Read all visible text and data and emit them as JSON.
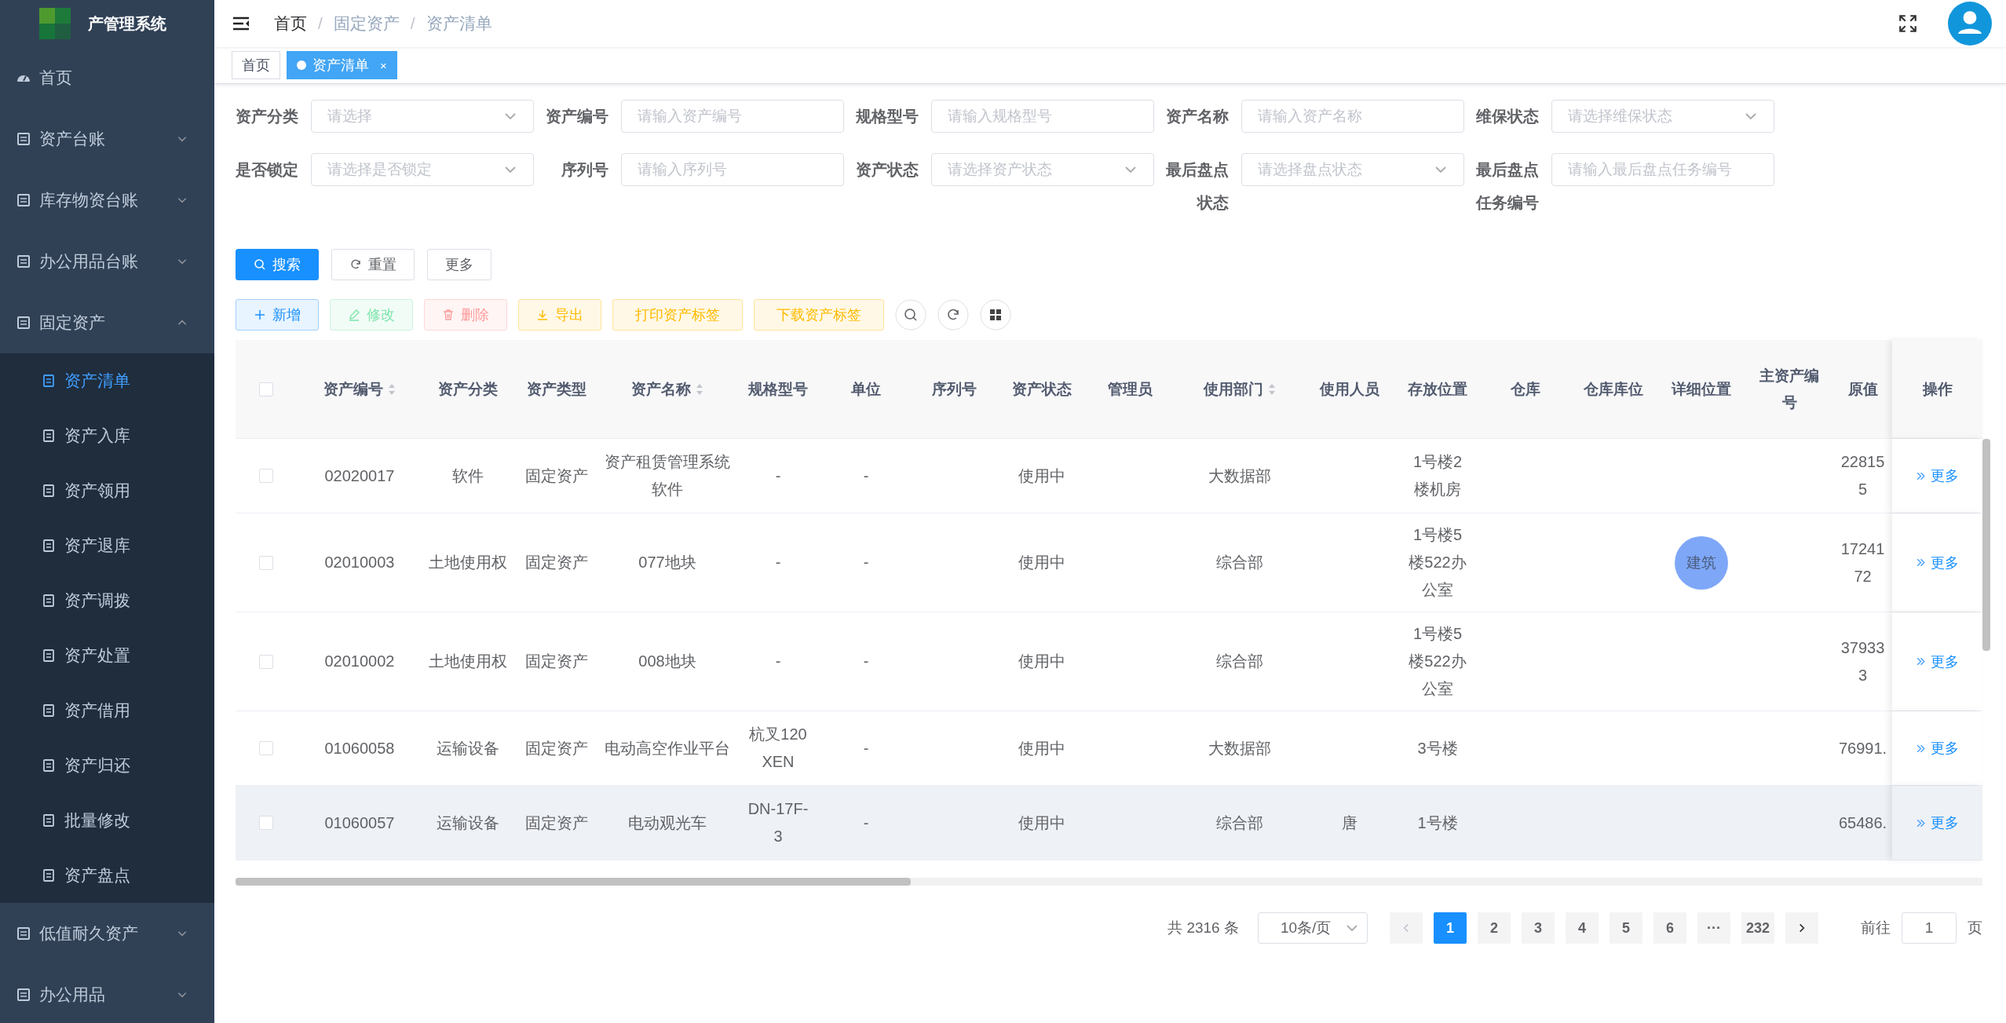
{
  "app": {
    "title": "产管理系统"
  },
  "sidebar": {
    "items": [
      {
        "label": "首页",
        "selected": false
      },
      {
        "label": "资产台账",
        "selected": false,
        "expanded": false
      },
      {
        "label": "库存物资台账",
        "selected": false,
        "expanded": false
      },
      {
        "label": "办公用品台账",
        "selected": false,
        "expanded": false
      },
      {
        "label": "固定资产",
        "selected": false,
        "expanded": true,
        "children": [
          {
            "label": "资产清单",
            "selected": true
          },
          {
            "label": "资产入库",
            "selected": false
          },
          {
            "label": "资产领用",
            "selected": false
          },
          {
            "label": "资产退库",
            "selected": false
          },
          {
            "label": "资产调拨",
            "selected": false
          },
          {
            "label": "资产处置",
            "selected": false
          },
          {
            "label": "资产借用",
            "selected": false
          },
          {
            "label": "资产归还",
            "selected": false
          },
          {
            "label": "批量修改",
            "selected": false
          },
          {
            "label": "资产盘点",
            "selected": false
          }
        ]
      },
      {
        "label": "低值耐久资产",
        "selected": false,
        "expanded": false
      },
      {
        "label": "办公用品",
        "selected": false,
        "expanded": false
      }
    ]
  },
  "breadcrumb": [
    "首页",
    "固定资产",
    "资产清单"
  ],
  "breadcrumb_separator": "/",
  "tags": [
    {
      "label": "首页",
      "selected": false
    },
    {
      "label": "资产清单",
      "selected": true,
      "close": "×"
    }
  ],
  "filters": [
    {
      "label": "资产分类",
      "kind": "select",
      "placeholder": "请选择"
    },
    {
      "label": "资产编号",
      "kind": "input",
      "placeholder": "请输入资产编号"
    },
    {
      "label": "规格型号",
      "kind": "input",
      "placeholder": "请输入规格型号"
    },
    {
      "label": "资产名称",
      "kind": "input",
      "placeholder": "请输入资产名称"
    },
    {
      "label": "维保状态",
      "kind": "select",
      "placeholder": "请选择维保状态"
    },
    {
      "label": "是否锁定",
      "kind": "select",
      "placeholder": "请选择是否锁定"
    },
    {
      "label": "序列号",
      "kind": "input",
      "placeholder": "请输入序列号"
    },
    {
      "label": "资产状态",
      "kind": "select",
      "placeholder": "请选择资产状态"
    },
    {
      "label": "最后盘点状态",
      "kind": "select",
      "placeholder": "请选择盘点状态"
    },
    {
      "label": "最后盘点任务编号",
      "kind": "input",
      "placeholder": "请输入最后盘点任务编号"
    }
  ],
  "form_buttons": [
    {
      "label": "搜索",
      "kind": "primary"
    },
    {
      "label": "重置",
      "kind": "reset"
    },
    {
      "label": "更多",
      "kind": "plain"
    }
  ],
  "toolbar": [
    {
      "label": "新增",
      "kind": "add",
      "disabled": false
    },
    {
      "label": "修改",
      "kind": "edit",
      "disabled": true
    },
    {
      "label": "删除",
      "kind": "delete",
      "disabled": true
    },
    {
      "label": "导出",
      "kind": "export",
      "disabled": false
    },
    {
      "label": "打印资产标签",
      "kind": "label",
      "disabled": false
    },
    {
      "label": "下载资产标签",
      "kind": "label",
      "disabled": false
    }
  ],
  "table": {
    "select_all": {
      "checked": false
    },
    "columns": [
      {
        "label": "资产编号",
        "sortable": true
      },
      {
        "label": "资产分类",
        "sortable": false
      },
      {
        "label": "资产类型",
        "sortable": false
      },
      {
        "label": "资产名称",
        "sortable": true
      },
      {
        "label": "规格型号",
        "sortable": false
      },
      {
        "label": "单位",
        "sortable": false
      },
      {
        "label": "序列号",
        "sortable": false
      },
      {
        "label": "资产状态",
        "sortable": false
      },
      {
        "label": "管理员",
        "sortable": false
      },
      {
        "label": "使用部门",
        "sortable": true
      },
      {
        "label": "使用人员",
        "sortable": false
      },
      {
        "label": "存放位置",
        "sortable": false
      },
      {
        "label": "仓库",
        "sortable": false
      },
      {
        "label": "仓库库位",
        "sortable": false
      },
      {
        "label": "详细位置",
        "sortable": false
      },
      {
        "label": "主资产编号",
        "sortable": false
      },
      {
        "label": "原值",
        "sortable": false
      }
    ],
    "action_column": "操作",
    "rows": [
      {
        "checked": false,
        "hovered": false,
        "action": "更多",
        "cells": [
          "02020017",
          "软件",
          "固定资产",
          "资产租赁管理系统软件",
          "-",
          "-",
          null,
          "使用中",
          null,
          "大数据部",
          null,
          "1号楼2楼机房",
          null,
          null,
          null,
          null,
          "22815\n5"
        ]
      },
      {
        "checked": false,
        "hovered": false,
        "action": "更多",
        "cells": [
          "02010003",
          "土地使用权",
          "固定资产",
          "077地块",
          "-",
          "-",
          null,
          "使用中",
          null,
          "综合部",
          null,
          "1号楼5楼522办公室",
          null,
          null,
          {
            "kind": "badge",
            "text": "建筑"
          },
          null,
          "17241\n72"
        ]
      },
      {
        "checked": false,
        "hovered": false,
        "action": "更多",
        "cells": [
          "02010002",
          "土地使用权",
          "固定资产",
          "008地块",
          "-",
          "-",
          null,
          "使用中",
          null,
          "综合部",
          null,
          "1号楼5楼522办公室",
          null,
          null,
          null,
          null,
          "37933\n3"
        ]
      },
      {
        "checked": false,
        "hovered": false,
        "action": "更多",
        "cells": [
          "01060058",
          "运输设备",
          "固定资产",
          "电动高空作业平台",
          "杭叉120XEN",
          "-",
          null,
          "使用中",
          null,
          "大数据部",
          null,
          "3号楼",
          null,
          null,
          null,
          null,
          "76991."
        ]
      },
      {
        "checked": false,
        "hovered": true,
        "action": "更多",
        "cells": [
          "01060057",
          "运输设备",
          "固定资产",
          "电动观光车",
          "DN-17F-3",
          "-",
          null,
          "使用中",
          null,
          "综合部",
          "唐",
          "1号楼",
          null,
          null,
          null,
          null,
          "65486."
        ]
      }
    ]
  },
  "pagination": {
    "total": "共 2316 条",
    "page_size": "10条/页",
    "pages": [
      {
        "label": "1",
        "selected": true
      },
      {
        "label": "2",
        "selected": false
      },
      {
        "label": "3",
        "selected": false
      },
      {
        "label": "4",
        "selected": false
      },
      {
        "label": "5",
        "selected": false
      },
      {
        "label": "6",
        "selected": false
      },
      {
        "label": "···",
        "selected": false
      },
      {
        "label": "232",
        "selected": false
      }
    ],
    "goto_label": "前往",
    "goto_value": "1",
    "goto_suffix": "页"
  }
}
